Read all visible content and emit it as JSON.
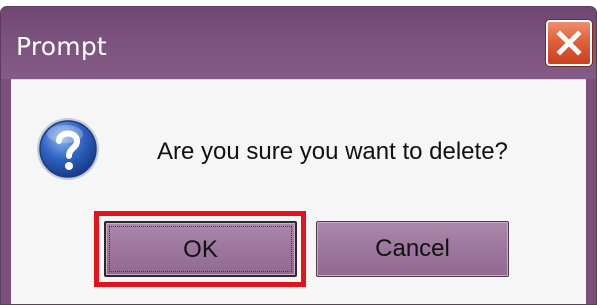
{
  "dialog": {
    "title": "Prompt",
    "message": "Are you sure you want to delete?",
    "icon": "question-icon",
    "close_icon": "close-icon"
  },
  "buttons": {
    "ok_label": "OK",
    "cancel_label": "Cancel"
  },
  "colors": {
    "titlebar": "#7b527e",
    "close_button": "#e2603c",
    "button_face": "#9c769c",
    "highlight": "#e2141d",
    "content_bg": "#f6f6f6"
  }
}
